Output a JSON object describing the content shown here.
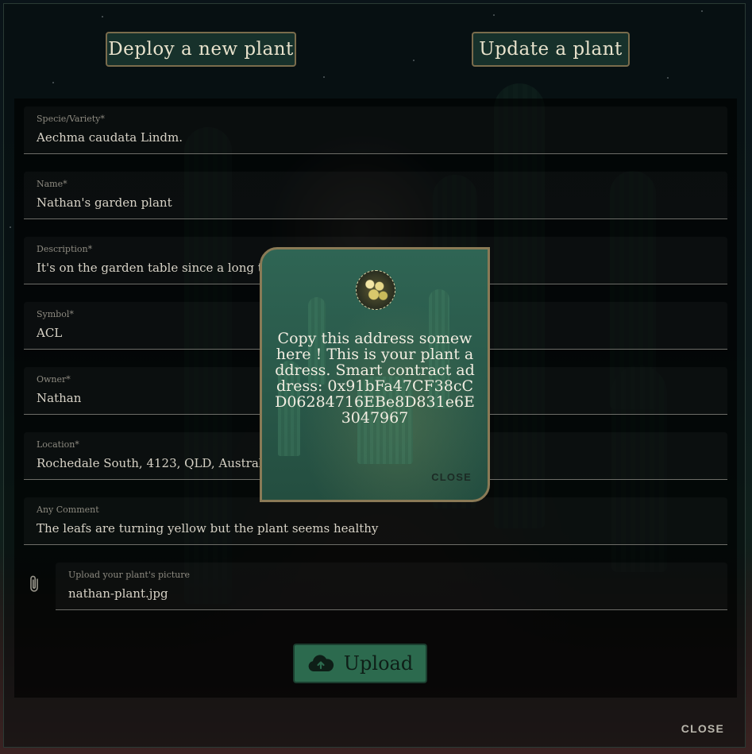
{
  "header": {
    "deploy_label": "Deploy a new plant",
    "update_label": "Update a plant"
  },
  "form": {
    "fields": [
      {
        "label": "Specie/Variety*",
        "value": "Aechma caudata Lindm."
      },
      {
        "label": "Name*",
        "value": "Nathan's garden plant"
      },
      {
        "label": "Description*",
        "value": "It's on the garden table since a long time, in"
      },
      {
        "label": "Symbol*",
        "value": "ACL"
      },
      {
        "label": "Owner*",
        "value": "Nathan"
      },
      {
        "label": "Location*",
        "value": "Rochedale South, 4123, QLD, Australia"
      },
      {
        "label": "Any Comment",
        "value": "The leafs are turning yellow but the plant seems healthy"
      }
    ],
    "file": {
      "label": "Upload your plant's picture",
      "value": "nathan-plant.jpg"
    },
    "upload_label": "Upload",
    "upload_icon": "cloud-upload-icon",
    "attach_icon": "paperclip-icon"
  },
  "dialog": {
    "close_label": "CLOSE"
  },
  "popup": {
    "message": "Copy this address somewhere ! This is your plant address. Smart contract address: 0x91bFa47CF38cCD06284716EBe8D831e6E3047967",
    "close_label": "CLOSE",
    "icon": "seed-pod-icon"
  },
  "colors": {
    "accent_green": "#2c6a4e",
    "border_gold": "#8a7a56",
    "popup_bg": "#2a5a4b"
  }
}
